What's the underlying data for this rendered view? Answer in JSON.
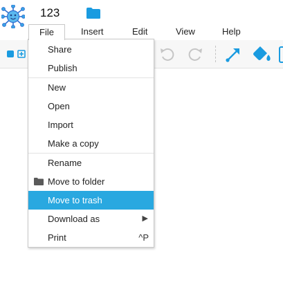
{
  "app": {
    "document_title": "123",
    "logo_icon": "spider-mascot-icon",
    "accent_color": "#29a8e0"
  },
  "menubar": {
    "items": [
      {
        "label": "File",
        "active": true
      },
      {
        "label": "Insert"
      },
      {
        "label": "Edit"
      },
      {
        "label": "View"
      },
      {
        "label": "Help"
      }
    ]
  },
  "toolbar": {
    "icons": [
      "shape-square-icon",
      "add-shape-icon",
      "undo-icon",
      "redo-icon",
      "connector-arrow-icon",
      "fill-bucket-icon",
      "frame-icon"
    ]
  },
  "file_menu": {
    "items": [
      {
        "label": "Share"
      },
      {
        "label": "Publish"
      },
      {
        "label": "New"
      },
      {
        "label": "Open"
      },
      {
        "label": "Import"
      },
      {
        "label": "Make a copy"
      },
      {
        "label": "Rename"
      },
      {
        "label": "Move to folder",
        "icon": "folder-icon"
      },
      {
        "label": "Move to trash",
        "highlighted": true
      },
      {
        "label": "Download as",
        "submenu_arrow": "▶"
      },
      {
        "label": "Print",
        "shortcut": "^P"
      }
    ]
  }
}
